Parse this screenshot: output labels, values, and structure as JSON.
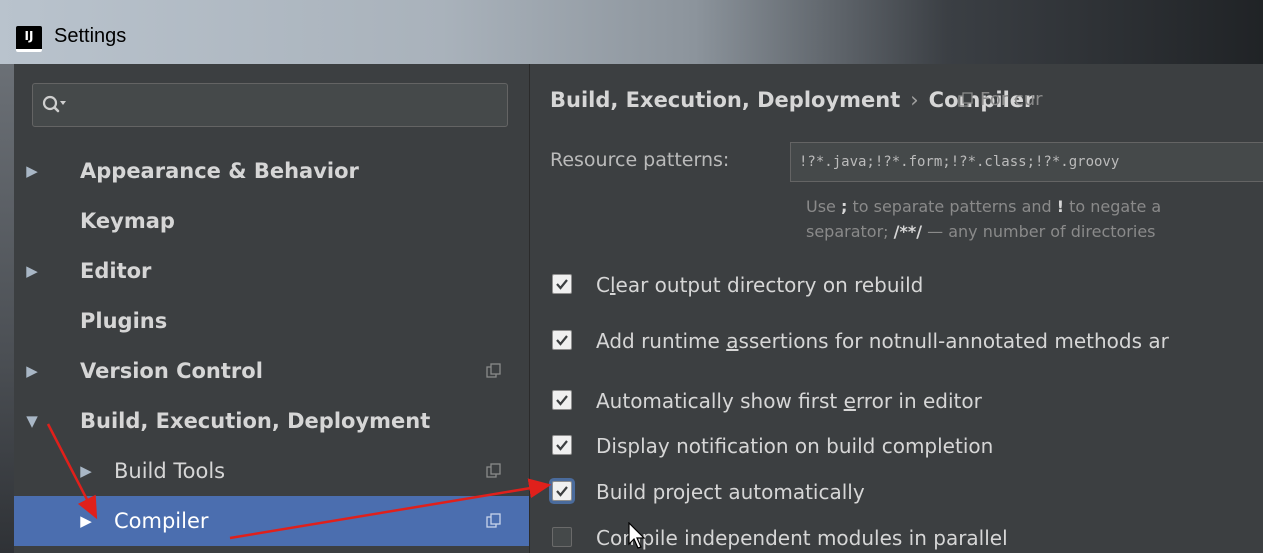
{
  "window": {
    "title": "Settings",
    "app_icon_text": "IJ"
  },
  "search": {
    "value": "",
    "placeholder": ""
  },
  "sidebar": {
    "items": [
      {
        "label": "Appearance & Behavior",
        "arrow": "▶"
      },
      {
        "label": "Keymap",
        "arrow": ""
      },
      {
        "label": "Editor",
        "arrow": "▶"
      },
      {
        "label": "Plugins",
        "arrow": ""
      },
      {
        "label": "Version Control",
        "arrow": "▶"
      },
      {
        "label": "Build, Execution, Deployment",
        "arrow": "▼"
      },
      {
        "label": "Build Tools",
        "arrow": "▶"
      },
      {
        "label": "Compiler",
        "arrow": "▶"
      }
    ]
  },
  "content": {
    "breadcrumb": {
      "part1": "Build, Execution, Deployment",
      "separator": "›",
      "part2": "Compiler"
    },
    "for_current": "For cur",
    "resource_patterns": {
      "label": "Resource patterns:",
      "value": "!?*.java;!?*.form;!?*.class;!?*.groovy"
    },
    "hint": {
      "line1_a": "Use ",
      "line1_b": ";",
      "line1_c": " to separate patterns and ",
      "line1_d": "!",
      "line1_e": " to negate a",
      "line2_a": "separator; ",
      "line2_b": "/**/",
      "line2_c": " — any number of directories"
    },
    "checkboxes": [
      {
        "pre": "C",
        "u": "l",
        "post": "ear output directory on rebuild",
        "checked": true
      },
      {
        "pre": "Add runtime ",
        "u": "a",
        "post": "ssertions for notnull-annotated methods ar",
        "checked": true
      },
      {
        "pre": "Automatically show first ",
        "u": "e",
        "post": "rror in editor",
        "checked": true
      },
      {
        "pre": "Display notification on build completion",
        "u": "",
        "post": "",
        "checked": true
      },
      {
        "pre": "Build project automatically",
        "u": "",
        "post": "",
        "checked": true
      },
      {
        "pre": "Compile independent modules in parallel",
        "u": "",
        "post": "",
        "checked": false
      }
    ]
  },
  "colors": {
    "background": "#3c3f41",
    "selection": "#4b6eaf",
    "text": "#d6d6d6",
    "annotation_arrow": "#e0201b"
  }
}
